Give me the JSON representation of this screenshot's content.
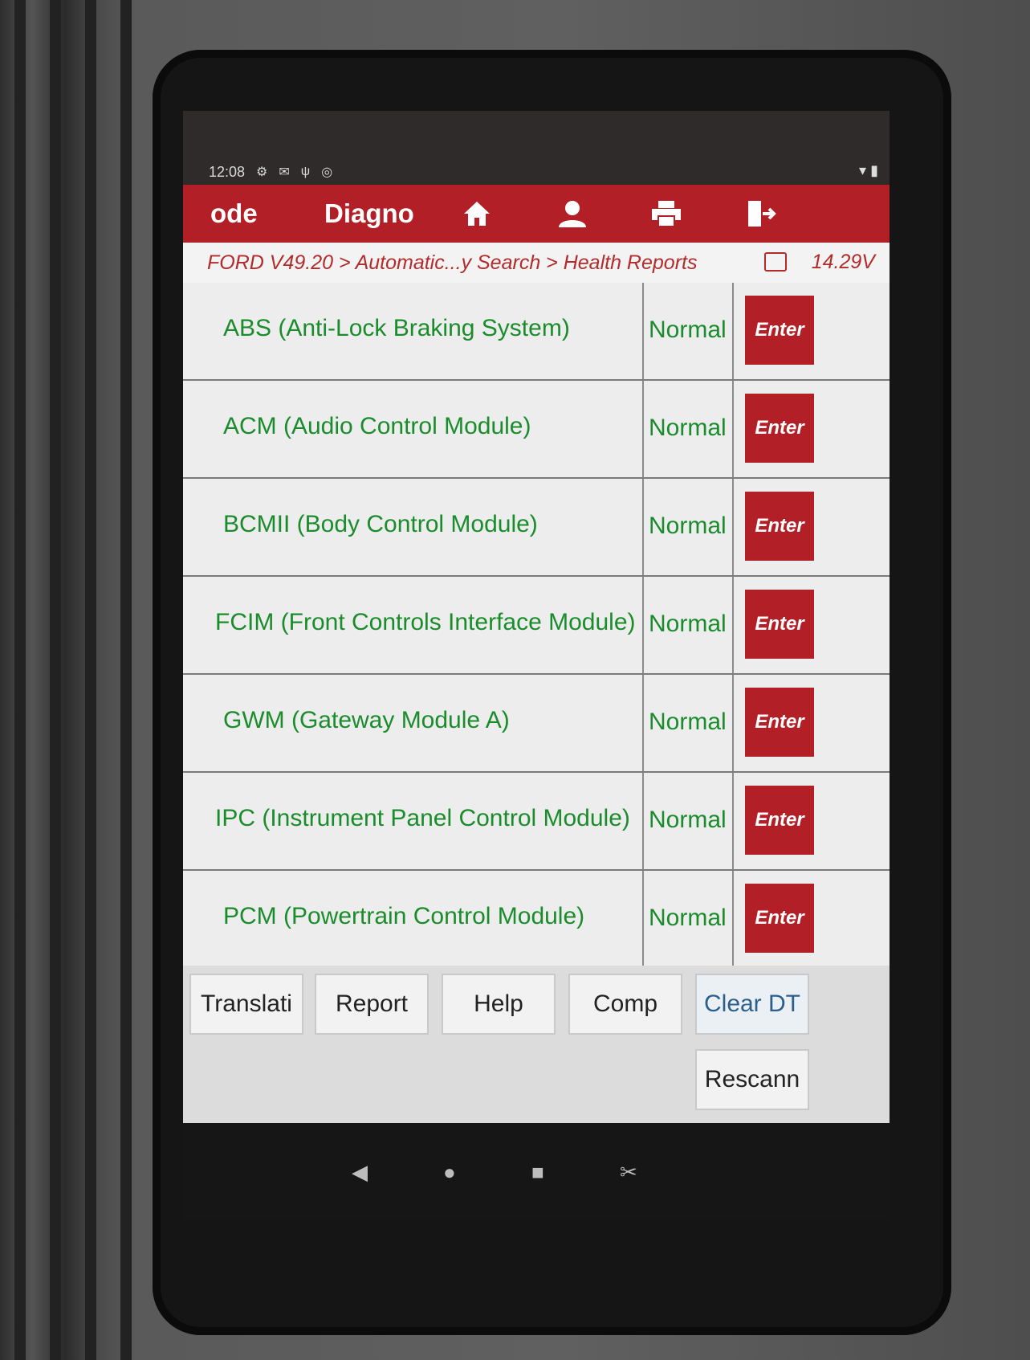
{
  "status_bar": {
    "time": "12:08",
    "icons": [
      "gear-icon",
      "mail-icon",
      "usb-icon",
      "circle-icon"
    ],
    "right_icons": [
      "wifi-icon",
      "battery-icon"
    ]
  },
  "header": {
    "left_label": "ode",
    "title": "Diagno",
    "icons": [
      "home-icon",
      "user-icon",
      "printer-icon",
      "exit-icon"
    ]
  },
  "breadcrumb": {
    "path": "FORD V49.20 > Automatic...y Search > Health Reports",
    "voltage": "14.29V"
  },
  "modules": [
    {
      "name": "ABS (Anti-Lock Braking System)",
      "status": "Normal",
      "button": "Enter"
    },
    {
      "name": "ACM (Audio Control Module)",
      "status": "Normal",
      "button": "Enter"
    },
    {
      "name": "BCMII (Body Control Module)",
      "status": "Normal",
      "button": "Enter"
    },
    {
      "name": "FCIM (Front Controls Interface Module)",
      "status": "Normal",
      "button": "Enter"
    },
    {
      "name": "GWM (Gateway Module A)",
      "status": "Normal",
      "button": "Enter"
    },
    {
      "name": "IPC (Instrument Panel Control Module)",
      "status": "Normal",
      "button": "Enter"
    },
    {
      "name": "PCM (Powertrain Control Module)",
      "status": "Normal",
      "button": "Enter"
    }
  ],
  "footer_buttons": {
    "translation": "Translati",
    "report": "Report",
    "help": "Help",
    "compare": "Comp",
    "clear_dtc": "Clear DT",
    "rescan": "Rescann"
  },
  "nav": [
    "back-icon",
    "home-circle-icon",
    "recents-icon",
    "screenshot-icon"
  ],
  "colors": {
    "brand_red": "#b21f26",
    "status_green": "#1a8c2c",
    "breadcrumb_red": "#b32b2b"
  }
}
